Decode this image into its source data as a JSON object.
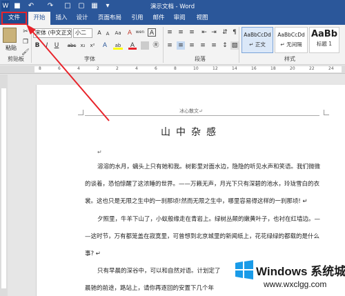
{
  "window": {
    "title": "演示文档 - Word",
    "qat": [
      "save-icon",
      "undo-icon",
      "redo-icon",
      "new-icon",
      "open-icon",
      "print-icon"
    ]
  },
  "tabs": [
    "文件",
    "开始",
    "插入",
    "设计",
    "页面布局",
    "引用",
    "邮件",
    "审阅",
    "视图"
  ],
  "ribbon": {
    "clipboard": {
      "paste_label": "粘贴",
      "group_label": "剪贴板"
    },
    "font": {
      "font_name": "宋体 (中文正文)",
      "font_size": "小二",
      "group_label": "字体",
      "bold": "B",
      "italic": "I",
      "underline": "U",
      "strike": "abc",
      "sub": "x₂",
      "sup": "x²",
      "clear": "A",
      "color_a": "A",
      "highlight": "ab",
      "font_color": "A",
      "aa_label": "Aa",
      "grow": "A",
      "shrink": "A",
      "wen": "wen",
      "char_border": "A"
    },
    "paragraph": {
      "group_label": "段落"
    },
    "styles": {
      "group_label": "样式",
      "items": [
        {
          "sample": "AaBbCcDd",
          "name": "↵ 正文"
        },
        {
          "sample": "AaBbCcDd",
          "name": "↵ 无间隔"
        },
        {
          "sample": "AaBb",
          "name": "标题 1"
        }
      ]
    }
  },
  "ruler": {
    "numbers": [
      "8",
      "6",
      "4",
      "2",
      "2",
      "4",
      "6",
      "8",
      "10",
      "12",
      "14",
      "16",
      "18",
      "20",
      "22",
      "24"
    ]
  },
  "document": {
    "header": "冰心散文↵",
    "title": "山中杂感",
    "empty_line": "↵",
    "paragraphs": [
      [
        "溶溶的水月，螭头上只有她和我。树影里对面水边，隐隐的听见水声和笑语。我们微微",
        "的谈着，恐怕惊醒了这浓睡的世界。——万籁无声，月光下只有深碧的池水，玲珑雪白的衣",
        "裳。这也只是无限之生中的一刹那顷!然而无限之生中，哪里容易得这样的一刹那顷! ↵"
      ],
      [
        "夕照里，牛羊下山了，小蚁般缘走在青岩上。绿树丛颠的嫩黄叶子，也衬在红墙边。—",
        "—这时节，万有都笼盖在寂寞里，可曾想到北京城里的新闻纸上，花花绿绿的都载的是什么",
        "事? ↵"
      ],
      [
        "只有早晨的深谷中，可以和自然对语。计划定了",
        "晨驰的前途，路站上，请你再逐回的安置下几个年"
      ]
    ]
  },
  "watermark": {
    "brand": "Windows 系统城",
    "url": "www.wxclgg.com"
  },
  "colors": {
    "title_bar": "#2b579a",
    "ribbon_bg": "#f3f3f3",
    "arrow": "#e8232a",
    "font_color_bar": "#e8232a"
  }
}
